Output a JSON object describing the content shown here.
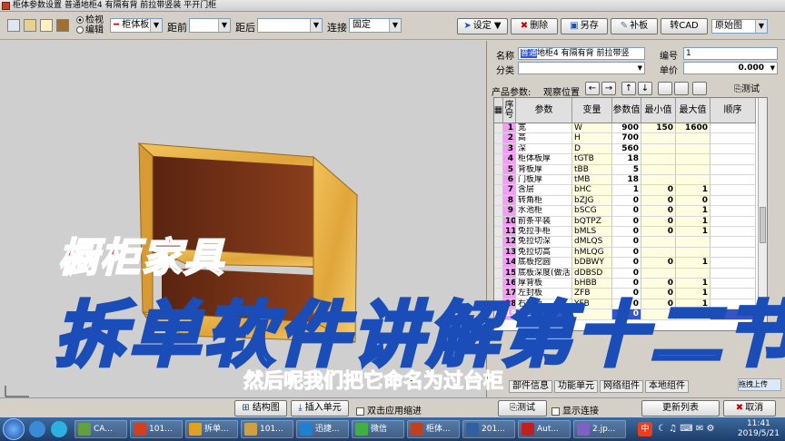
{
  "window": {
    "title": "柜体参数设置 普通地柜4 有隔有背 前拉带竖装 平开门柜"
  },
  "toolbar": {
    "radio_view": "检视",
    "radio_edit": "编辑",
    "part_combo": "柜体板",
    "front_label": "距前",
    "front_value": "",
    "back_label": "距后",
    "back_value": "",
    "connect_label": "连接",
    "connect_value": "固定",
    "settings_label": "设定",
    "delete_label": "删除",
    "save_as_label": "另存",
    "patch_label": "补板",
    "cad_label": "转CAD",
    "view_combo": "原始图"
  },
  "panel": {
    "name_label": "名称",
    "name_value_selected": "普通",
    "name_value": "地柜4 有隔有背 前拉带竖",
    "code_label": "编号",
    "code_value": "1",
    "category_label": "分类",
    "category_value": "",
    "price_label": "单价",
    "price_value": "0.000",
    "params_label": "产品参数:",
    "view_pos_label": "观察位置",
    "test_label": "测试"
  },
  "grid": {
    "headers": [
      "序号",
      "参数",
      "变量",
      "参数值",
      "最小值",
      "最大值",
      "顺序"
    ],
    "rows": [
      {
        "no": "1",
        "name": "宽",
        "var": "W",
        "val": "900",
        "min": "150",
        "max": "1600"
      },
      {
        "no": "2",
        "name": "高",
        "var": "H",
        "val": "700",
        "min": "",
        "max": ""
      },
      {
        "no": "3",
        "name": "深",
        "var": "D",
        "val": "560",
        "min": "",
        "max": ""
      },
      {
        "no": "4",
        "name": "柜体板厚",
        "var": "tGTB",
        "val": "18",
        "min": "",
        "max": ""
      },
      {
        "no": "5",
        "name": "背板厚",
        "var": "tBB",
        "val": "5",
        "min": "",
        "max": ""
      },
      {
        "no": "6",
        "name": "门板厚",
        "var": "tMB",
        "val": "18",
        "min": "",
        "max": ""
      },
      {
        "no": "7",
        "name": "含层",
        "var": "bHC",
        "val": "1",
        "min": "0",
        "max": "1"
      },
      {
        "no": "8",
        "name": "转角柜",
        "var": "bZJG",
        "val": "0",
        "min": "0",
        "max": "0"
      },
      {
        "no": "9",
        "name": "水池柜",
        "var": "bSCG",
        "val": "0",
        "min": "0",
        "max": "1"
      },
      {
        "no": "10",
        "name": "前条平装",
        "var": "bQTPZ",
        "val": "0",
        "min": "0",
        "max": "1"
      },
      {
        "no": "11",
        "name": "免拉手柜",
        "var": "bMLS",
        "val": "0",
        "min": "0",
        "max": "1"
      },
      {
        "no": "12",
        "name": "免拉切深",
        "var": "dMLQS",
        "val": "0",
        "min": "",
        "max": ""
      },
      {
        "no": "13",
        "name": "免拉切高",
        "var": "hMLQG",
        "val": "0",
        "min": "",
        "max": ""
      },
      {
        "no": "14",
        "name": "底板挖圆",
        "var": "bDBWY",
        "val": "0",
        "min": "0",
        "max": "1"
      },
      {
        "no": "15",
        "name": "底板深度(做活",
        "var": "dDBSD",
        "val": "0",
        "min": "",
        "max": ""
      },
      {
        "no": "16",
        "name": "厚背板",
        "var": "bHBB",
        "val": "0",
        "min": "0",
        "max": "1"
      },
      {
        "no": "17",
        "name": "左封板",
        "var": "ZFB",
        "val": "0",
        "min": "0",
        "max": "1"
      },
      {
        "no": "18",
        "name": "右封板",
        "var": "YFB",
        "val": "0",
        "min": "0",
        "max": "1"
      },
      {
        "no": "19",
        "name": "顶封板",
        "var": "DFB",
        "val": "0",
        "min": "0",
        "max": "1"
      }
    ]
  },
  "tabs": [
    "部件信息",
    "功能单元",
    "网络组件",
    "本地组件"
  ],
  "bottom": {
    "struct_label": "结构图",
    "insert_label": "插入单元",
    "dblclick_label": "双击应用缩进",
    "test_label": "测试",
    "show_conn_label": "显示连接",
    "refresh_label": "更新列表",
    "cancel_label": "取消"
  },
  "taskbar": {
    "items": [
      "CA...",
      "101...",
      "拆单...",
      "101...",
      "迅捷...",
      "微信",
      "柜体...",
      "201...",
      "Aut...",
      "2.jp..."
    ],
    "time": "11:41",
    "date": "2019/5/21",
    "ime_label": "中",
    "upload_label": "拖拽上传"
  },
  "overlay": {
    "tag": "橱柜家具",
    "title": "拆单软件讲解第十二节",
    "subtitle": "然后呢我们把它命名为过台柜"
  },
  "colors": {
    "pink_col": "#f0a0f0",
    "yellow_col": "#fffde0",
    "overlay_red": "#ff2a2a",
    "overlay_blue": "#1a4db8"
  }
}
